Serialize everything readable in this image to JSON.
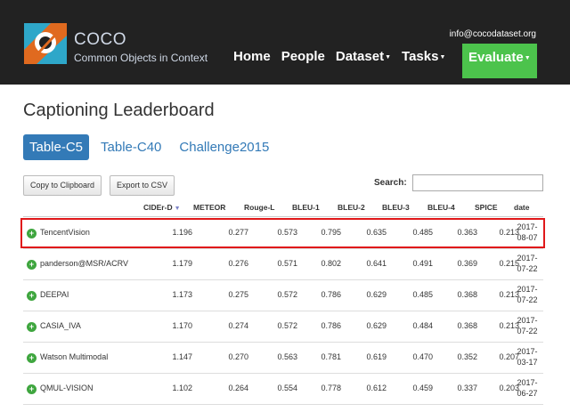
{
  "header": {
    "brand_name": "COCO",
    "brand_tagline": "Common Objects in Context",
    "email": "info@cocodataset.org",
    "nav": [
      {
        "label": "Home",
        "dropdown": false
      },
      {
        "label": "People",
        "dropdown": false
      },
      {
        "label": "Dataset",
        "dropdown": true
      },
      {
        "label": "Tasks",
        "dropdown": true
      },
      {
        "label": "Evaluate",
        "dropdown": true,
        "active": true
      }
    ]
  },
  "page": {
    "title": "Captioning Leaderboard",
    "tabs": [
      {
        "label": "Table-C5",
        "active": true
      },
      {
        "label": "Table-C40"
      },
      {
        "label": "Challenge2015"
      }
    ],
    "buttons": {
      "copy": "Copy to Clipboard",
      "export": "Export to CSV"
    },
    "search_label": "Search:"
  },
  "table": {
    "columns": [
      "CIDEr-D",
      "METEOR",
      "Rouge-L",
      "BLEU-1",
      "BLEU-2",
      "BLEU-3",
      "BLEU-4",
      "SPICE",
      "date"
    ],
    "sorted_column": "CIDEr-D",
    "rows": [
      {
        "name": "TencentVision",
        "values": [
          "1.196",
          "0.277",
          "0.573",
          "0.795",
          "0.635",
          "0.485",
          "0.363",
          "0.213"
        ],
        "date_year": "2017-",
        "date_md": "08-07",
        "highlighted": true
      },
      {
        "name": "panderson@MSR/ACRV",
        "values": [
          "1.179",
          "0.276",
          "0.571",
          "0.802",
          "0.641",
          "0.491",
          "0.369",
          "0.215"
        ],
        "date_year": "2017-",
        "date_md": "07-22"
      },
      {
        "name": "DEEPAI",
        "values": [
          "1.173",
          "0.275",
          "0.572",
          "0.786",
          "0.629",
          "0.485",
          "0.368",
          "0.213"
        ],
        "date_year": "2017-",
        "date_md": "07-22"
      },
      {
        "name": "CASIA_IVA",
        "values": [
          "1.170",
          "0.274",
          "0.572",
          "0.786",
          "0.629",
          "0.484",
          "0.368",
          "0.213"
        ],
        "date_year": "2017-",
        "date_md": "07-22"
      },
      {
        "name": "Watson Multimodal",
        "values": [
          "1.147",
          "0.270",
          "0.563",
          "0.781",
          "0.619",
          "0.470",
          "0.352",
          "0.207"
        ],
        "date_year": "2017-",
        "date_md": "03-17"
      },
      {
        "name": "QMUL-VISION",
        "values": [
          "1.102",
          "0.264",
          "0.554",
          "0.778",
          "0.612",
          "0.459",
          "0.337",
          "0.203"
        ],
        "date_year": "2017-",
        "date_md": "06-27"
      }
    ]
  },
  "colors": {
    "accent": "#337ab7",
    "active_nav": "#4cc34c",
    "highlight": "#e0181a",
    "header_bg": "#222222"
  }
}
